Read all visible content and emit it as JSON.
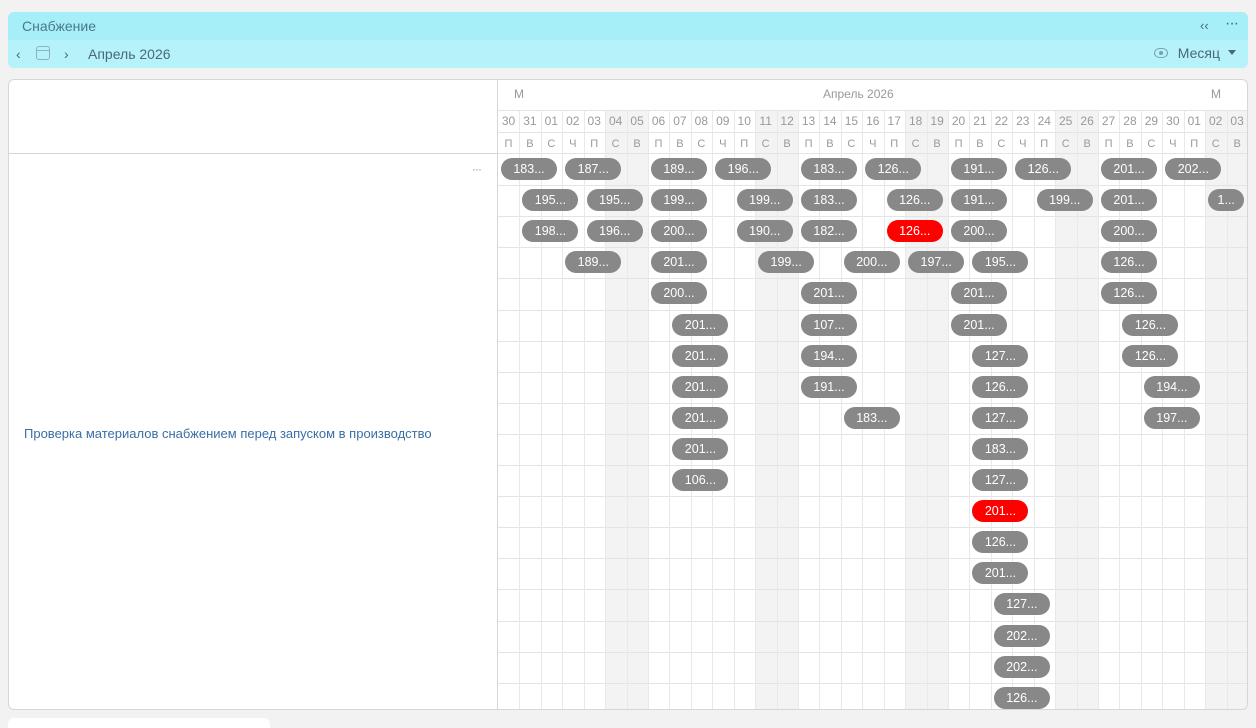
{
  "header": {
    "title": "Снабжение",
    "period": "Апрель 2026",
    "view_label": "Месяц",
    "icons": [
      "collapse-left-icon",
      "more-horizontal-icon",
      "chevron-left-icon",
      "calendar-icon",
      "chevron-right-icon",
      "eye-icon",
      "caret-down-icon"
    ]
  },
  "row": {
    "label": "Проверка материалов снабжением перед запуском в производство"
  },
  "timeline": {
    "month_left": "М",
    "month_center": "Апрель 2026",
    "month_right": "М",
    "days": [
      {
        "n": "30",
        "w": "П",
        "we": false
      },
      {
        "n": "31",
        "w": "В",
        "we": false
      },
      {
        "n": "01",
        "w": "С",
        "we": false
      },
      {
        "n": "02",
        "w": "Ч",
        "we": false
      },
      {
        "n": "03",
        "w": "П",
        "we": false
      },
      {
        "n": "04",
        "w": "С",
        "we": true
      },
      {
        "n": "05",
        "w": "В",
        "we": true
      },
      {
        "n": "06",
        "w": "П",
        "we": false
      },
      {
        "n": "07",
        "w": "В",
        "we": false
      },
      {
        "n": "08",
        "w": "С",
        "we": false
      },
      {
        "n": "09",
        "w": "Ч",
        "we": false
      },
      {
        "n": "10",
        "w": "П",
        "we": false
      },
      {
        "n": "11",
        "w": "С",
        "we": true
      },
      {
        "n": "12",
        "w": "В",
        "we": true
      },
      {
        "n": "13",
        "w": "П",
        "we": false
      },
      {
        "n": "14",
        "w": "В",
        "we": false
      },
      {
        "n": "15",
        "w": "С",
        "we": false
      },
      {
        "n": "16",
        "w": "Ч",
        "we": false
      },
      {
        "n": "17",
        "w": "П",
        "we": false
      },
      {
        "n": "18",
        "w": "С",
        "we": true
      },
      {
        "n": "19",
        "w": "В",
        "we": true
      },
      {
        "n": "20",
        "w": "П",
        "we": false
      },
      {
        "n": "21",
        "w": "В",
        "we": false
      },
      {
        "n": "22",
        "w": "С",
        "we": false
      },
      {
        "n": "23",
        "w": "Ч",
        "we": false
      },
      {
        "n": "24",
        "w": "П",
        "we": false
      },
      {
        "n": "25",
        "w": "С",
        "we": true
      },
      {
        "n": "26",
        "w": "В",
        "we": true
      },
      {
        "n": "27",
        "w": "П",
        "we": false
      },
      {
        "n": "28",
        "w": "В",
        "we": false
      },
      {
        "n": "29",
        "w": "С",
        "we": false
      },
      {
        "n": "30",
        "w": "Ч",
        "we": false
      },
      {
        "n": "01",
        "w": "П",
        "we": false
      },
      {
        "n": "02",
        "w": "С",
        "we": true
      },
      {
        "n": "03",
        "w": "В",
        "we": true
      }
    ],
    "chips": [
      {
        "t": "183...",
        "d": 0,
        "r": 0
      },
      {
        "t": "187...",
        "d": 3,
        "r": 0
      },
      {
        "t": "189...",
        "d": 7,
        "r": 0
      },
      {
        "t": "196...",
        "d": 10,
        "r": 0
      },
      {
        "t": "183...",
        "d": 14,
        "r": 0
      },
      {
        "t": "126...",
        "d": 17,
        "r": 0
      },
      {
        "t": "191...",
        "d": 21,
        "r": 0
      },
      {
        "t": "126...",
        "d": 24,
        "r": 0
      },
      {
        "t": "201...",
        "d": 28,
        "r": 0
      },
      {
        "t": "202...",
        "d": 31,
        "r": 0
      },
      {
        "t": "195...",
        "d": 1,
        "r": 1
      },
      {
        "t": "195...",
        "d": 4,
        "r": 1
      },
      {
        "t": "199...",
        "d": 7,
        "r": 1
      },
      {
        "t": "199...",
        "d": 11,
        "r": 1
      },
      {
        "t": "183...",
        "d": 14,
        "r": 1
      },
      {
        "t": "126...",
        "d": 18,
        "r": 1
      },
      {
        "t": "191...",
        "d": 21,
        "r": 1
      },
      {
        "t": "199...",
        "d": 25,
        "r": 1
      },
      {
        "t": "201...",
        "d": 28,
        "r": 1
      },
      {
        "t": "1...",
        "d": 33,
        "r": 1
      },
      {
        "t": "198...",
        "d": 1,
        "r": 2
      },
      {
        "t": "196...",
        "d": 4,
        "r": 2
      },
      {
        "t": "200...",
        "d": 7,
        "r": 2
      },
      {
        "t": "190...",
        "d": 11,
        "r": 2
      },
      {
        "t": "182...",
        "d": 14,
        "r": 2
      },
      {
        "t": "126...",
        "d": 18,
        "r": 2,
        "red": true
      },
      {
        "t": "200...",
        "d": 21,
        "r": 2
      },
      {
        "t": "200...",
        "d": 28,
        "r": 2
      },
      {
        "t": "189...",
        "d": 3,
        "r": 3
      },
      {
        "t": "201...",
        "d": 7,
        "r": 3
      },
      {
        "t": "199...",
        "d": 12,
        "r": 3
      },
      {
        "t": "200...",
        "d": 16,
        "r": 3
      },
      {
        "t": "197...",
        "d": 19,
        "r": 3
      },
      {
        "t": "195...",
        "d": 22,
        "r": 3
      },
      {
        "t": "126...",
        "d": 28,
        "r": 3
      },
      {
        "t": "200...",
        "d": 7,
        "r": 4
      },
      {
        "t": "201...",
        "d": 14,
        "r": 4
      },
      {
        "t": "201...",
        "d": 21,
        "r": 4
      },
      {
        "t": "126...",
        "d": 28,
        "r": 4
      },
      {
        "t": "201...",
        "d": 8,
        "r": 5
      },
      {
        "t": "107...",
        "d": 14,
        "r": 5
      },
      {
        "t": "201...",
        "d": 21,
        "r": 5
      },
      {
        "t": "126...",
        "d": 29,
        "r": 5
      },
      {
        "t": "201...",
        "d": 8,
        "r": 6
      },
      {
        "t": "194...",
        "d": 14,
        "r": 6
      },
      {
        "t": "127...",
        "d": 22,
        "r": 6
      },
      {
        "t": "126...",
        "d": 29,
        "r": 6
      },
      {
        "t": "201...",
        "d": 8,
        "r": 7
      },
      {
        "t": "191...",
        "d": 14,
        "r": 7
      },
      {
        "t": "126...",
        "d": 22,
        "r": 7
      },
      {
        "t": "194...",
        "d": 30,
        "r": 7
      },
      {
        "t": "201...",
        "d": 8,
        "r": 8
      },
      {
        "t": "183...",
        "d": 16,
        "r": 8
      },
      {
        "t": "127...",
        "d": 22,
        "r": 8
      },
      {
        "t": "197...",
        "d": 30,
        "r": 8
      },
      {
        "t": "201...",
        "d": 8,
        "r": 9
      },
      {
        "t": "183...",
        "d": 22,
        "r": 9
      },
      {
        "t": "106...",
        "d": 8,
        "r": 10
      },
      {
        "t": "127...",
        "d": 22,
        "r": 10
      },
      {
        "t": "201...",
        "d": 22,
        "r": 11,
        "red": true
      },
      {
        "t": "126...",
        "d": 22,
        "r": 12
      },
      {
        "t": "201...",
        "d": 22,
        "r": 13
      },
      {
        "t": "127...",
        "d": 23,
        "r": 14
      },
      {
        "t": "202...",
        "d": 23,
        "r": 15
      },
      {
        "t": "202...",
        "d": 23,
        "r": 16
      },
      {
        "t": "126...",
        "d": 23,
        "r": 17
      }
    ]
  }
}
